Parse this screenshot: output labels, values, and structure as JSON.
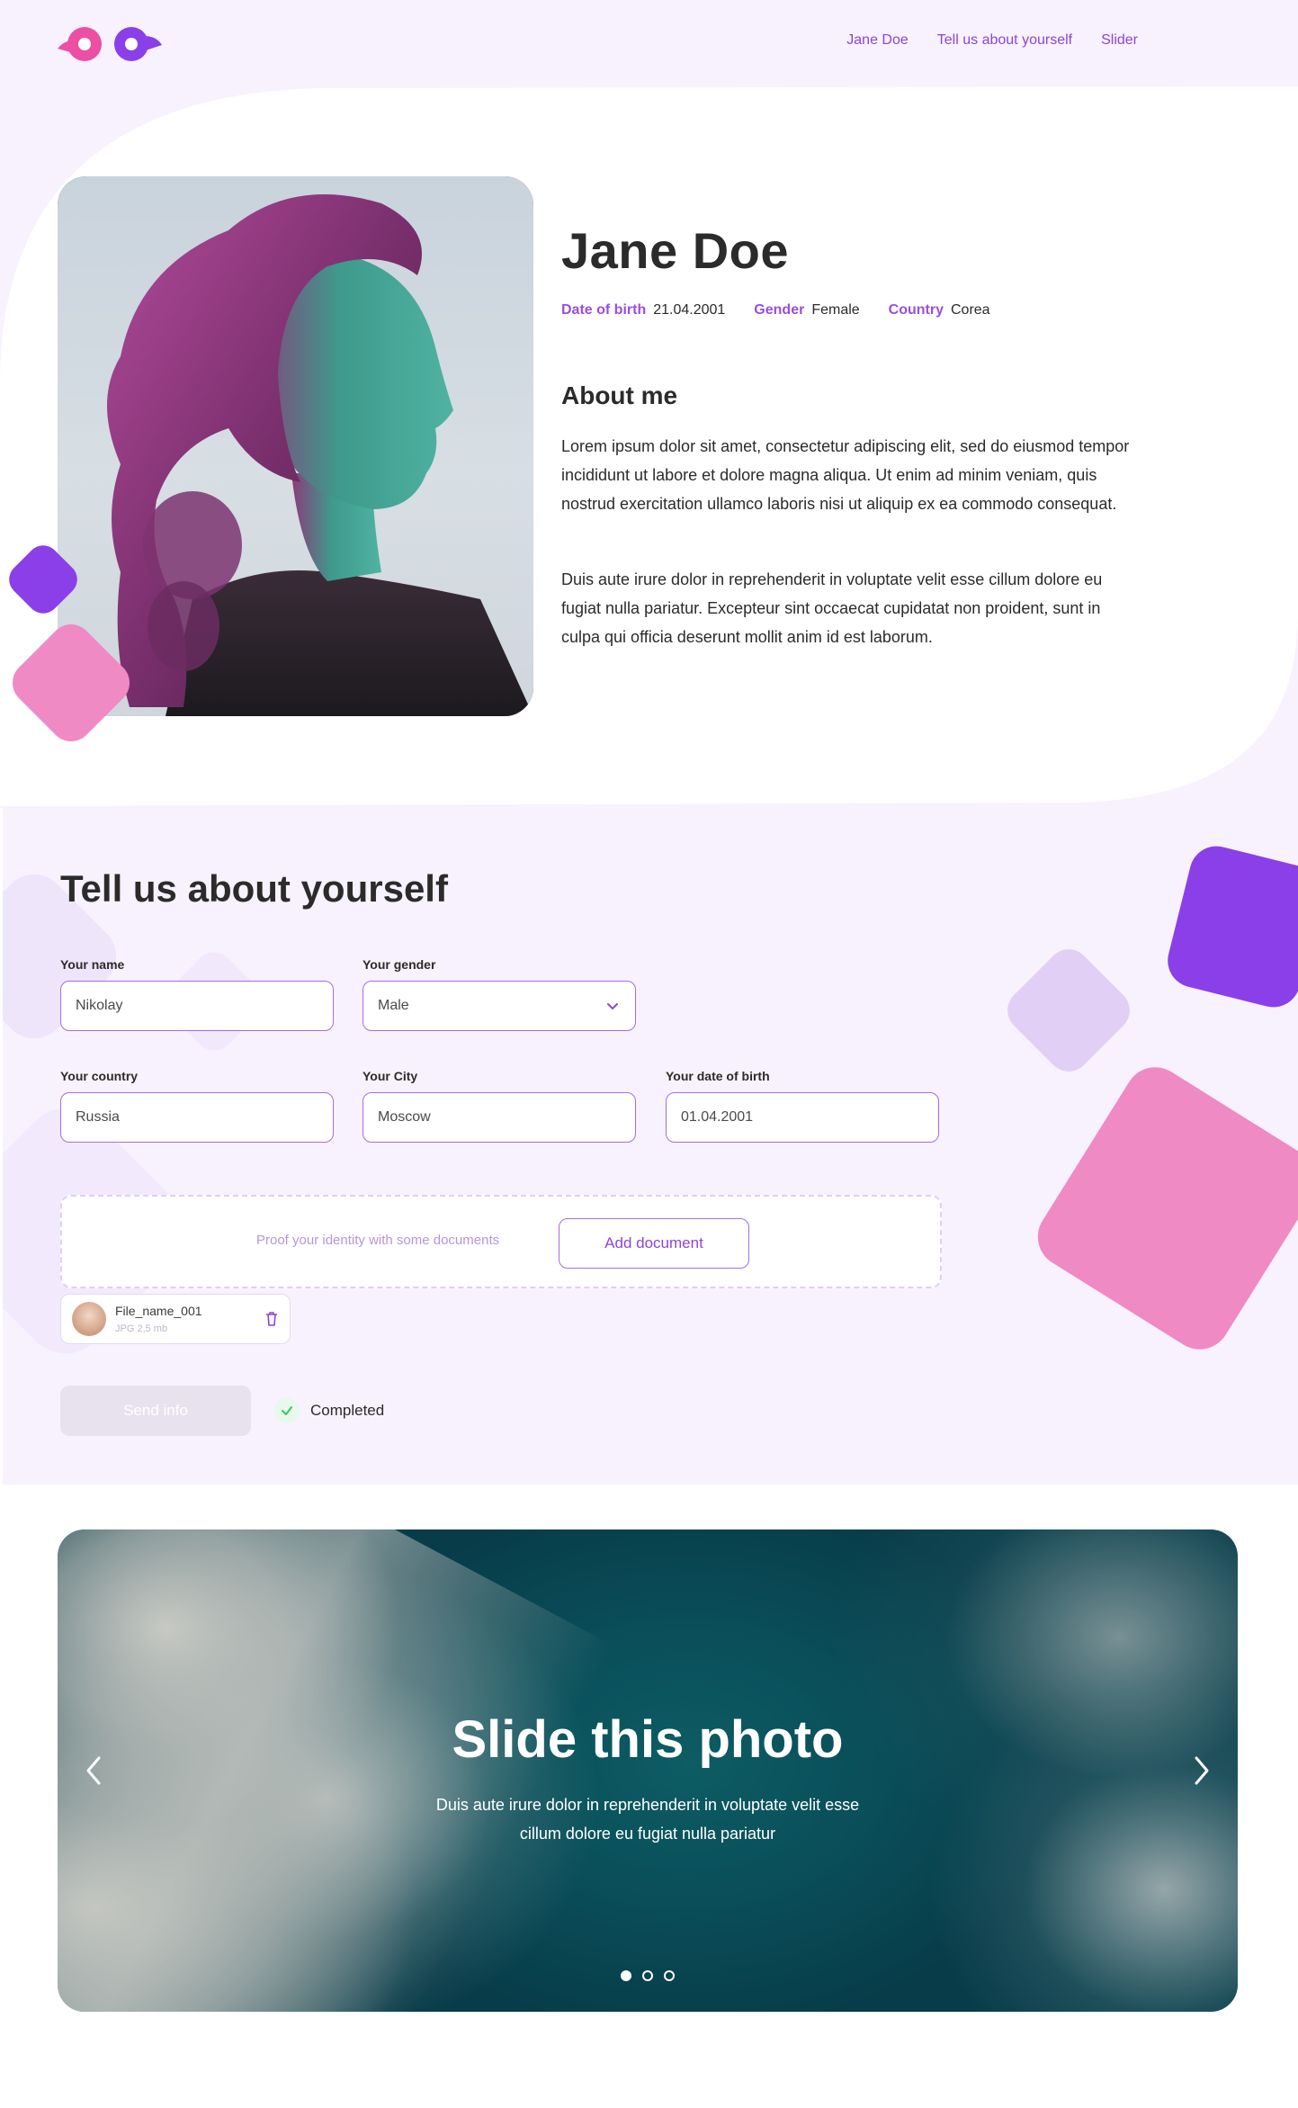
{
  "header": {
    "nav": [
      "Jane Doe",
      "Tell us about yourself",
      "Slider"
    ]
  },
  "profile": {
    "name": "Jane Doe",
    "meta": [
      {
        "label": "Date of birth",
        "value": "21.04.2001"
      },
      {
        "label": "Gender",
        "value": "Female"
      },
      {
        "label": "Country",
        "value": "Corea"
      }
    ],
    "about_title": "About me",
    "about_paragraphs": [
      "Lorem ipsum dolor sit amet, consectetur adipiscing elit, sed do eiusmod tempor incididunt ut labore et dolore magna aliqua. Ut enim ad minim veniam, quis nostrud exercitation ullamco laboris nisi ut aliquip ex ea commodo consequat.",
      "Duis aute irure dolor in reprehenderit in voluptate velit esse cillum dolore eu fugiat nulla pariatur. Excepteur sint occaecat cupidatat non proident, sunt in culpa qui officia deserunt mollit anim id est laborum."
    ]
  },
  "form": {
    "title": "Tell us about yourself",
    "fields": {
      "name": {
        "label": "Your name",
        "value": "Nikolay"
      },
      "gender": {
        "label": "Your gender",
        "value": "Male"
      },
      "country": {
        "label": "Your country",
        "value": "Russia"
      },
      "city": {
        "label": "Your City",
        "value": "Moscow"
      },
      "dob": {
        "label": "Your date of birth",
        "value": "01.04.2001"
      }
    },
    "upload_hint": "Proof your identity with some documents",
    "add_document": "Add document",
    "file": {
      "name": "File_name_001",
      "meta": "JPG 2,5 mb"
    },
    "send": "Send info",
    "status": "Completed"
  },
  "slider": {
    "title": "Slide this photo",
    "text_line1": "Duis aute irure dolor in reprehenderit in voluptate velit esse",
    "text_line2": "cillum dolore eu fugiat nulla pariatur",
    "slides_total": 3,
    "active_slide": 1
  },
  "colors": {
    "accent": "#8e44d4",
    "purple_shape": "#8b3fe8",
    "pink_shape": "#ef8ac4",
    "lilac_shape": "#e2cff6",
    "section_bg": "#f8f2fe"
  }
}
